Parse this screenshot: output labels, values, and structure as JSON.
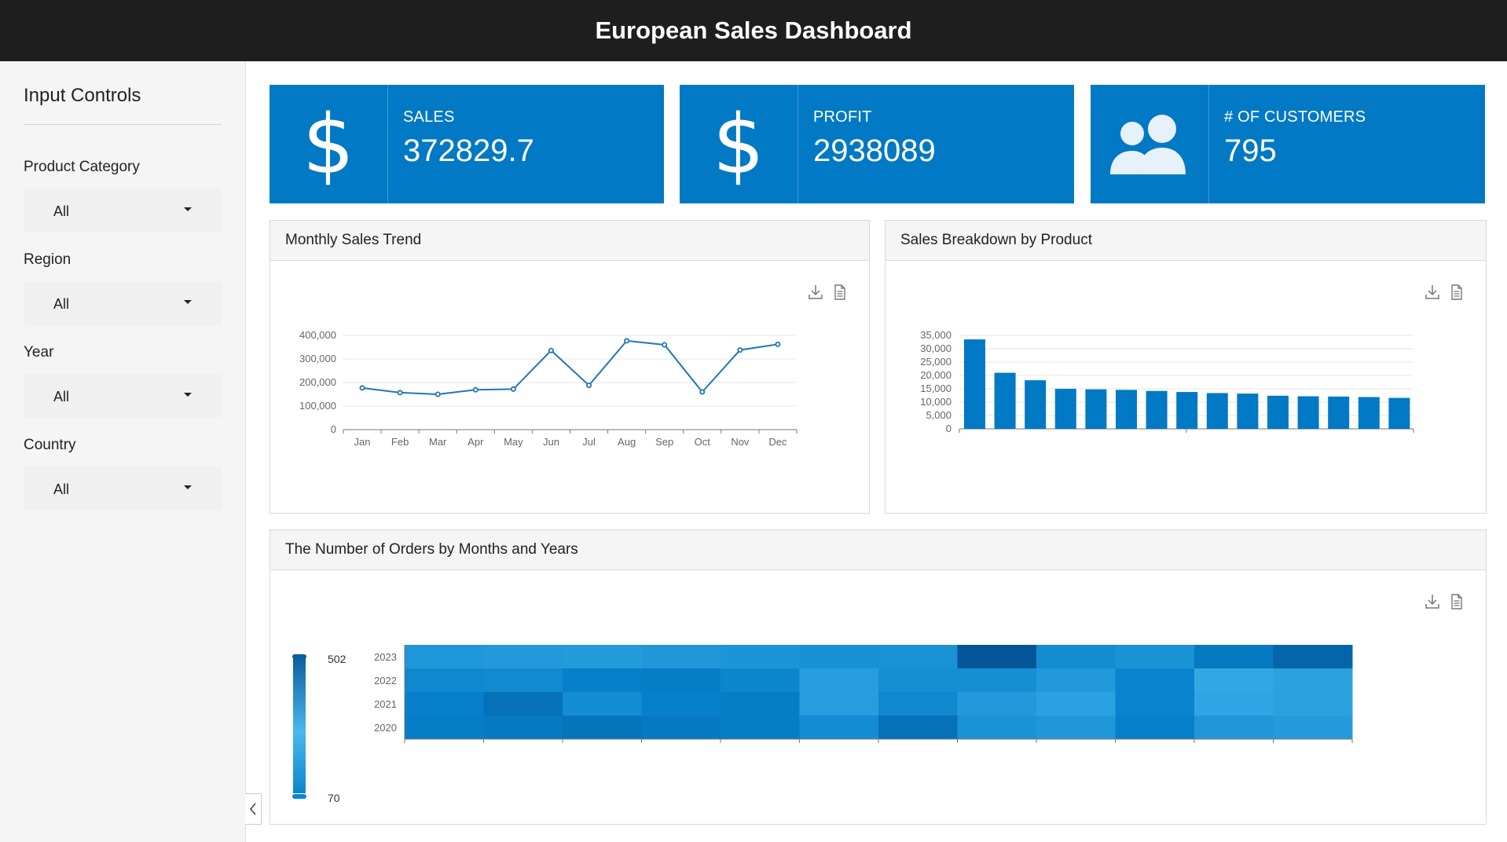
{
  "app": {
    "title": "European Sales Dashboard"
  },
  "sidebar": {
    "title": "Input Controls",
    "controls": [
      {
        "label": "Product Category",
        "value": "All"
      },
      {
        "label": "Region",
        "value": "All"
      },
      {
        "label": "Year",
        "value": "All"
      },
      {
        "label": "Country",
        "value": "All"
      }
    ]
  },
  "kpis": [
    {
      "label": "SALES",
      "value": "372829.7",
      "icon": "dollar-icon"
    },
    {
      "label": "PROFIT",
      "value": "2938089",
      "icon": "dollar-icon"
    },
    {
      "label": "# OF CUSTOMERS",
      "value": "795",
      "icon": "users-icon"
    }
  ],
  "panels": {
    "trend": {
      "title": "Monthly Sales Trend"
    },
    "breakdown": {
      "title": "Sales Breakdown by Product"
    },
    "orders": {
      "title": "The Number of Orders by Months and Years"
    }
  },
  "colors": {
    "topbar": "#1e1e1e",
    "accent": "#0279c4",
    "sidebar": "#f5f5f5"
  },
  "chart_data": [
    {
      "type": "line",
      "title": "Monthly Sales Trend",
      "categories": [
        "Jan",
        "Feb",
        "Mar",
        "Apr",
        "May",
        "Jun",
        "Jul",
        "Aug",
        "Sep",
        "Oct",
        "Nov",
        "Dec"
      ],
      "values": [
        177000,
        157000,
        150000,
        169000,
        172000,
        336000,
        188000,
        377000,
        360000,
        160000,
        338000,
        362000
      ],
      "yticks": [
        "400,000",
        "300,000",
        "200,000",
        "100,000",
        "0"
      ],
      "ylim": [
        0,
        400000
      ],
      "grid": true
    },
    {
      "type": "bar",
      "title": "Sales Breakdown by Product",
      "values": [
        33500,
        21000,
        18200,
        15000,
        14800,
        14600,
        14200,
        13800,
        13400,
        13200,
        12400,
        12200,
        12100,
        11900,
        11600
      ],
      "yticks": [
        "35,000",
        "30,000",
        "25,000",
        "20,000",
        "15,000",
        "10,000",
        "5,000",
        "0"
      ],
      "ylim": [
        0,
        35000
      ],
      "grid": true
    },
    {
      "type": "heatmap",
      "title": "The Number of Orders by Months and Years",
      "years": [
        "2023",
        "2022",
        "2021",
        "2020"
      ],
      "columns": 12,
      "scale": {
        "max": "502",
        "min": "70"
      },
      "values": [
        [
          260,
          240,
          230,
          250,
          270,
          290,
          280,
          480,
          310,
          280,
          390,
          440
        ],
        [
          330,
          320,
          370,
          380,
          340,
          220,
          300,
          300,
          240,
          350,
          170,
          200
        ],
        [
          370,
          410,
          310,
          370,
          380,
          220,
          330,
          240,
          200,
          350,
          180,
          200
        ],
        [
          380,
          390,
          400,
          390,
          380,
          310,
          410,
          280,
          250,
          370,
          250,
          230
        ]
      ]
    }
  ]
}
